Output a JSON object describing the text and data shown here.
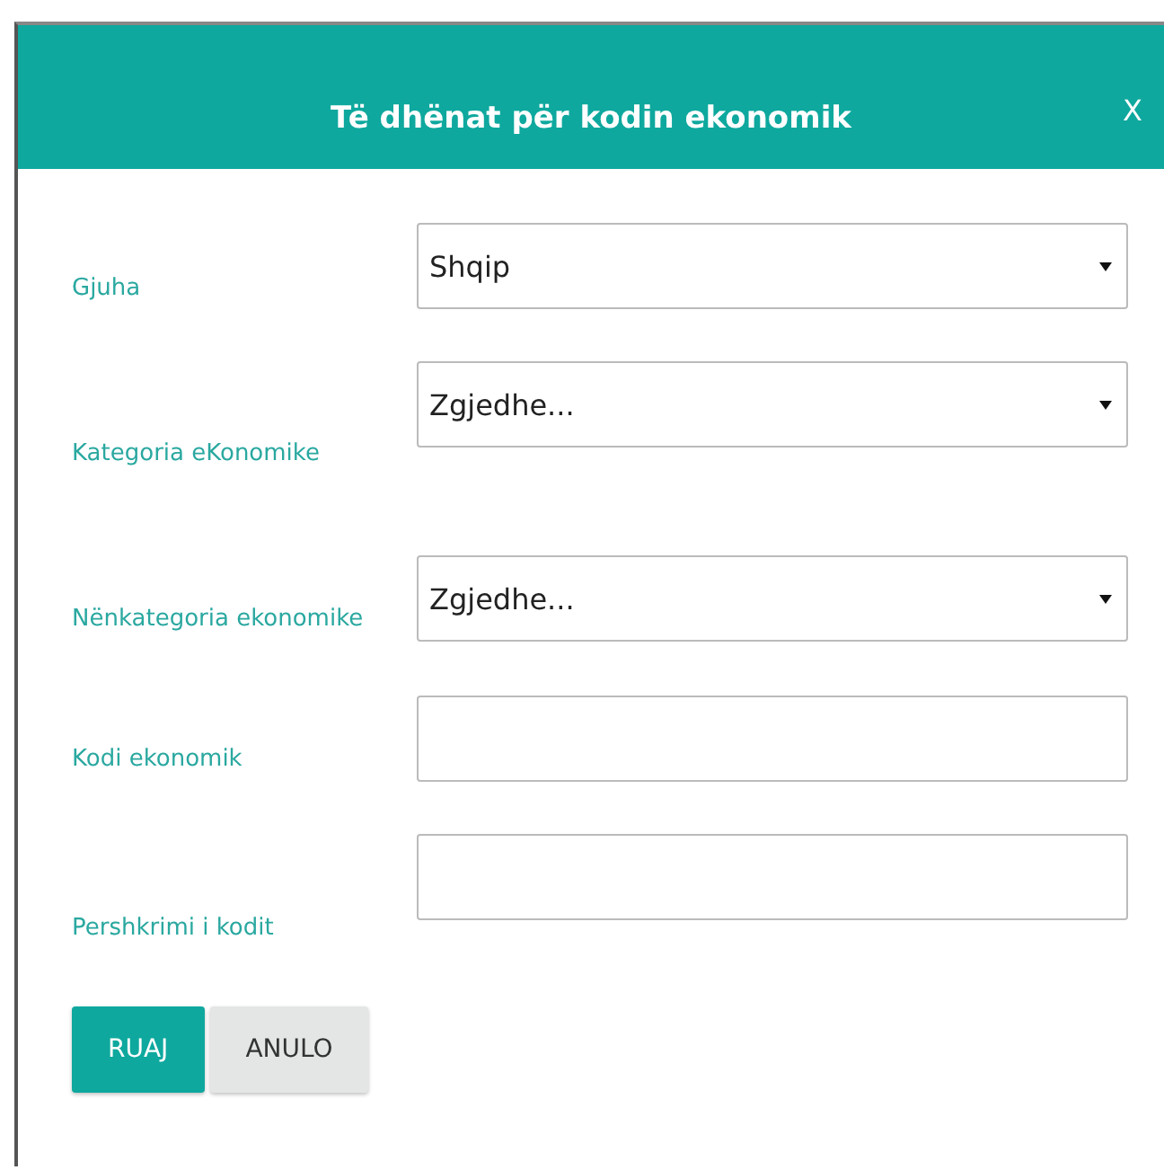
{
  "dialog": {
    "title": "Të dhënat për kodin ekonomik",
    "close": "X"
  },
  "fields": [
    {
      "label": "Gjuha",
      "kind": "select",
      "value": "Shqip"
    },
    {
      "label": "Kategoria eKonomike",
      "kind": "select",
      "value": "Zgjedhe..."
    },
    {
      "label": "Nënkategoria ekonomike",
      "kind": "select",
      "value": "Zgjedhe..."
    },
    {
      "label": "Kodi ekonomik",
      "kind": "text"
    },
    {
      "label": "Pershkrimi i kodit",
      "kind": "text"
    }
  ],
  "buttons": [
    {
      "label": "RUAJ",
      "kind": "primary"
    },
    {
      "label": "ANULO",
      "kind": "secondary"
    }
  ]
}
